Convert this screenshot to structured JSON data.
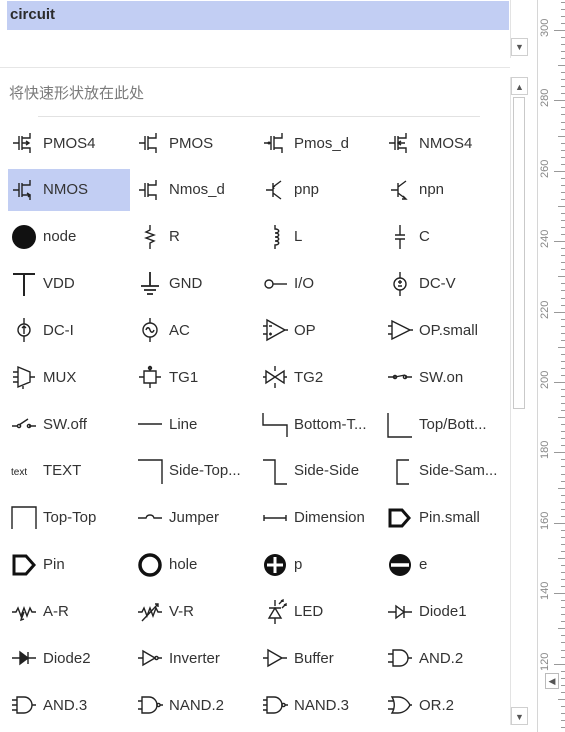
{
  "stencil": {
    "title": "circuit"
  },
  "quick_shapes": {
    "hint": "将快速形状放在此处"
  },
  "shapes": [
    {
      "label": "PMOS4",
      "icon": "pmos4-icon",
      "selected": false
    },
    {
      "label": "PMOS",
      "icon": "pmos-icon",
      "selected": false
    },
    {
      "label": "Pmos_d",
      "icon": "pmos-d-icon",
      "selected": false
    },
    {
      "label": "NMOS4",
      "icon": "nmos4-icon",
      "selected": false
    },
    {
      "label": "NMOS",
      "icon": "nmos-icon",
      "selected": true
    },
    {
      "label": "Nmos_d",
      "icon": "nmos-d-icon",
      "selected": false
    },
    {
      "label": "pnp",
      "icon": "pnp-icon",
      "selected": false
    },
    {
      "label": "npn",
      "icon": "npn-icon",
      "selected": false
    },
    {
      "label": "node",
      "icon": "node-icon",
      "selected": false
    },
    {
      "label": "R",
      "icon": "resistor-icon",
      "selected": false
    },
    {
      "label": "L",
      "icon": "inductor-icon",
      "selected": false
    },
    {
      "label": "C",
      "icon": "capacitor-icon",
      "selected": false
    },
    {
      "label": "VDD",
      "icon": "vdd-icon",
      "selected": false
    },
    {
      "label": "GND",
      "icon": "ground-icon",
      "selected": false
    },
    {
      "label": "I/O",
      "icon": "io-icon",
      "selected": false
    },
    {
      "label": "DC-V",
      "icon": "dc-voltage-icon",
      "selected": false
    },
    {
      "label": "DC-I",
      "icon": "dc-current-icon",
      "selected": false
    },
    {
      "label": "AC",
      "icon": "ac-source-icon",
      "selected": false
    },
    {
      "label": "OP",
      "icon": "opamp-icon",
      "selected": false
    },
    {
      "label": "OP.small",
      "icon": "opamp-small-icon",
      "selected": false
    },
    {
      "label": "MUX",
      "icon": "mux-icon",
      "selected": false
    },
    {
      "label": "TG1",
      "icon": "tg1-icon",
      "selected": false
    },
    {
      "label": "TG2",
      "icon": "tg2-icon",
      "selected": false
    },
    {
      "label": "SW.on",
      "icon": "switch-on-icon",
      "selected": false
    },
    {
      "label": "SW.off",
      "icon": "switch-off-icon",
      "selected": false
    },
    {
      "label": "Line",
      "icon": "line-icon",
      "selected": false
    },
    {
      "label": "Bottom-T...",
      "icon": "bottom-top-icon",
      "selected": false
    },
    {
      "label": "Top/Bott...",
      "icon": "top-bottom-icon",
      "selected": false
    },
    {
      "label": "TEXT",
      "icon": "text-icon",
      "selected": false
    },
    {
      "label": "Side-Top...",
      "icon": "side-top-icon",
      "selected": false
    },
    {
      "label": "Side-Side",
      "icon": "side-side-icon",
      "selected": false
    },
    {
      "label": "Side-Sam...",
      "icon": "side-same-icon",
      "selected": false
    },
    {
      "label": "Top-Top",
      "icon": "top-top-icon",
      "selected": false
    },
    {
      "label": "Jumper",
      "icon": "jumper-icon",
      "selected": false
    },
    {
      "label": "Dimension",
      "icon": "dimension-icon",
      "selected": false
    },
    {
      "label": "Pin.small",
      "icon": "pin-small-icon",
      "selected": false
    },
    {
      "label": "Pin",
      "icon": "pin-icon",
      "selected": false
    },
    {
      "label": "hole",
      "icon": "hole-icon",
      "selected": false
    },
    {
      "label": "p",
      "icon": "p-icon",
      "selected": false
    },
    {
      "label": "e",
      "icon": "e-icon",
      "selected": false
    },
    {
      "label": "A-R",
      "icon": "adjustable-resistor-icon",
      "selected": false
    },
    {
      "label": "V-R",
      "icon": "variable-resistor-icon",
      "selected": false
    },
    {
      "label": "LED",
      "icon": "led-icon",
      "selected": false
    },
    {
      "label": "Diode1",
      "icon": "diode1-icon",
      "selected": false
    },
    {
      "label": "Diode2",
      "icon": "diode2-icon",
      "selected": false
    },
    {
      "label": "Inverter",
      "icon": "inverter-icon",
      "selected": false
    },
    {
      "label": "Buffer",
      "icon": "buffer-icon",
      "selected": false
    },
    {
      "label": "AND.2",
      "icon": "and2-icon",
      "selected": false
    },
    {
      "label": "AND.3",
      "icon": "and3-icon",
      "selected": false
    },
    {
      "label": "NAND.2",
      "icon": "nand2-icon",
      "selected": false
    },
    {
      "label": "NAND.3",
      "icon": "nand3-icon",
      "selected": false
    },
    {
      "label": "OR.2",
      "icon": "or2-icon",
      "selected": false
    }
  ],
  "ruler": {
    "labels": [
      "300",
      "280",
      "260",
      "240",
      "220",
      "200",
      "180",
      "160",
      "140",
      "120"
    ]
  },
  "colors": {
    "selection": "#c2cef3"
  }
}
